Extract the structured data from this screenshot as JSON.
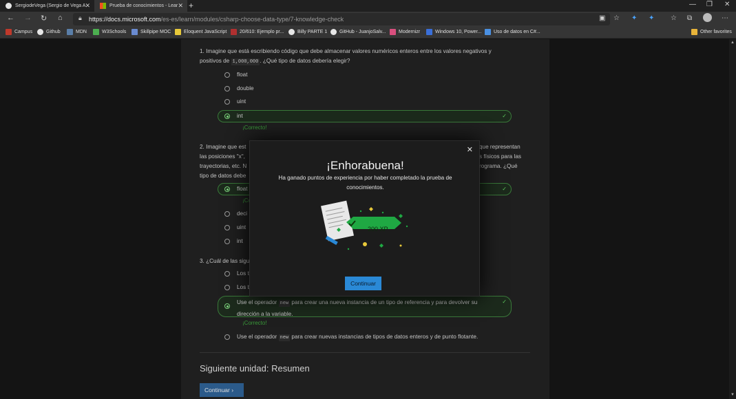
{
  "browser": {
    "tabs": [
      {
        "title": "SergiodeVega (Sergio de Vega A",
        "close": "✕"
      },
      {
        "title": "Prueba de conocimientos - Lear",
        "close": "✕"
      }
    ],
    "new_tab": "+",
    "window_controls": {
      "minimize": "—",
      "restore": "❐",
      "close": "✕"
    },
    "url_host": "https://docs.microsoft.com",
    "url_path": "/es-es/learn/modules/csharp-choose-data-type/7-knowledge-check",
    "bookmarks": [
      {
        "label": "Campus",
        "color": "#c0392b"
      },
      {
        "label": "Github",
        "color": "#e6e6e6"
      },
      {
        "label": "MDN",
        "color": "#5a7ea8"
      },
      {
        "label": "W3Schools",
        "color": "#4caf50"
      },
      {
        "label": "Skillpipe MOC",
        "color": "#6a8bd1"
      },
      {
        "label": "Eloquent JavaScript",
        "color": "#e8c93a"
      },
      {
        "label": "20/610: Ejemplo pr...",
        "color": "#b03030"
      },
      {
        "label": "Billy PARTE 1",
        "color": "#e6e6e6"
      },
      {
        "label": "GitHub - JuanjoSalv...",
        "color": "#e6e6e6"
      },
      {
        "label": "Modernizr",
        "color": "#d94f7e"
      },
      {
        "label": "Windows 10, Power...",
        "color": "#3a6fd8"
      },
      {
        "label": "Uso de datos en C#...",
        "color": "#4a90e2"
      }
    ],
    "other_favorites": "Other favorites"
  },
  "quiz": {
    "q1": {
      "text_a": "1. Imagine que está escribiendo código que debe almacenar valores numéricos enteros entre los valores negativos y",
      "text_b": "positivos de ",
      "code": "1,000,000",
      "text_c": ". ¿Qué tipo de datos debería elegir?",
      "options": [
        "float",
        "double",
        "uint",
        "int"
      ],
      "feedback": "¡Correcto!"
    },
    "q2": {
      "line1_left": "2. Imagine que est",
      "line1_right": "que representan",
      "line2_left": "las posiciones \"x\",",
      "line2_right": "s físicos para las",
      "line3_left": "trayectorias, etc. N",
      "line3_right": "rograma. ¿Qué",
      "line4_left": "tipo de datos debe",
      "options": [
        "float",
        "deci",
        "uint",
        "int"
      ],
      "feedback": "¡Co"
    },
    "q3": {
      "text": "3. ¿Cuál de las sigu",
      "opt1": "Los t",
      "opt2": "Los t",
      "opt3_a": "Use el operador ",
      "opt3_code": "new",
      "opt3_b": " para crear una nueva instancia de un tipo de referencia y para devolver su",
      "opt3_c": "dirección a la variable.",
      "feedback": "¡Correcto!",
      "opt4_a": "Use el operador ",
      "opt4_code": "new",
      "opt4_b": " para crear nuevas instancias de tipos de datos enteros y de punto flotante."
    },
    "next_unit": "Siguiente unidad: Resumen",
    "next_button": "Continuar"
  },
  "modal": {
    "title": "¡Enhorabuena!",
    "text": "Ha ganado puntos de experiencia por haber completado la prueba de conocimientos.",
    "xp": "200 XP",
    "button": "Continuar"
  },
  "colors": {
    "correct_green": "#3a9a3a",
    "accent_blue": "#2a89d6"
  }
}
